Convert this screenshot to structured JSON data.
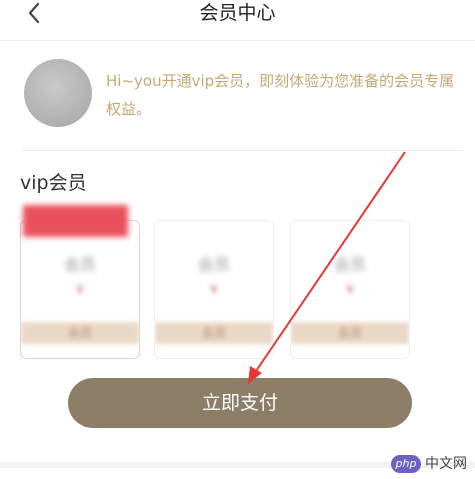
{
  "header": {
    "title": "会员中心",
    "back_icon": "chevron-left-icon"
  },
  "profile": {
    "message": "Hi~you开通vip会员，即刻体验为您准备的会员专属权益。"
  },
  "vip": {
    "section_title": "vip会员",
    "cards": [
      {
        "name": "会员",
        "price": "¥",
        "foot": "会员"
      },
      {
        "name": "会员",
        "price": "¥",
        "foot": "会员"
      },
      {
        "name": "会员",
        "price": "¥",
        "foot": "会员"
      }
    ]
  },
  "pay_button": {
    "label": "立即支付"
  },
  "colors": {
    "accent_text": "#c7a874",
    "button_bg": "#8d7e68",
    "annotation_arrow": "#e53935"
  },
  "watermark": {
    "logo": "php",
    "text": "中文网"
  }
}
